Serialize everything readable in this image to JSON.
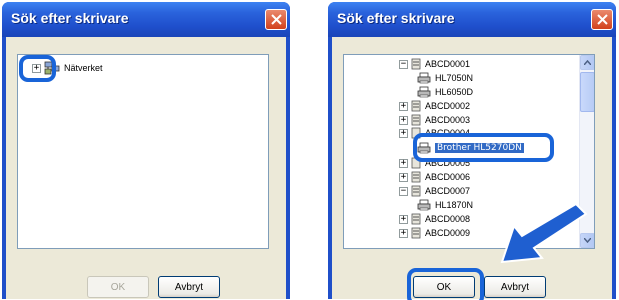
{
  "left_dialog": {
    "title": "Sök efter skrivare",
    "tree": [
      {
        "label": "Nätverket",
        "expander": "+"
      }
    ],
    "buttons": {
      "ok": "OK",
      "cancel": "Avbryt"
    },
    "ok_enabled": false
  },
  "right_dialog": {
    "title": "Sök efter skrivare",
    "tree": [
      {
        "label": "ABCD0001",
        "expander": "−",
        "icon": "computer-icon"
      },
      {
        "label": "HL7050N",
        "icon": "printer-icon"
      },
      {
        "label": "HL6050D",
        "icon": "printer-icon"
      },
      {
        "label": "ABCD0002",
        "expander": "+",
        "icon": "computer-icon"
      },
      {
        "label": "ABCD0003",
        "expander": "+",
        "icon": "computer-icon"
      },
      {
        "label": "ABCD0004",
        "expander": "+",
        "icon": "computer-icon"
      },
      {
        "label": "Brother HL5270DN",
        "icon": "printer-icon",
        "selected": true
      },
      {
        "label": "ABCD0005",
        "expander": "+",
        "icon": "computer-icon"
      },
      {
        "label": "ABCD0006",
        "expander": "+",
        "icon": "computer-icon"
      },
      {
        "label": "ABCD0007",
        "expander": "−",
        "icon": "computer-icon"
      },
      {
        "label": "HL1870N",
        "icon": "printer-icon"
      },
      {
        "label": "ABCD0008",
        "expander": "+",
        "icon": "computer-icon"
      },
      {
        "label": "ABCD0009",
        "expander": "+",
        "icon": "computer-icon"
      }
    ],
    "buttons": {
      "ok": "OK",
      "cancel": "Avbryt"
    },
    "ok_enabled": true
  },
  "colors": {
    "titlebar": "#2a63dc",
    "highlight": "#1964d8",
    "client": "#ece9d8"
  }
}
